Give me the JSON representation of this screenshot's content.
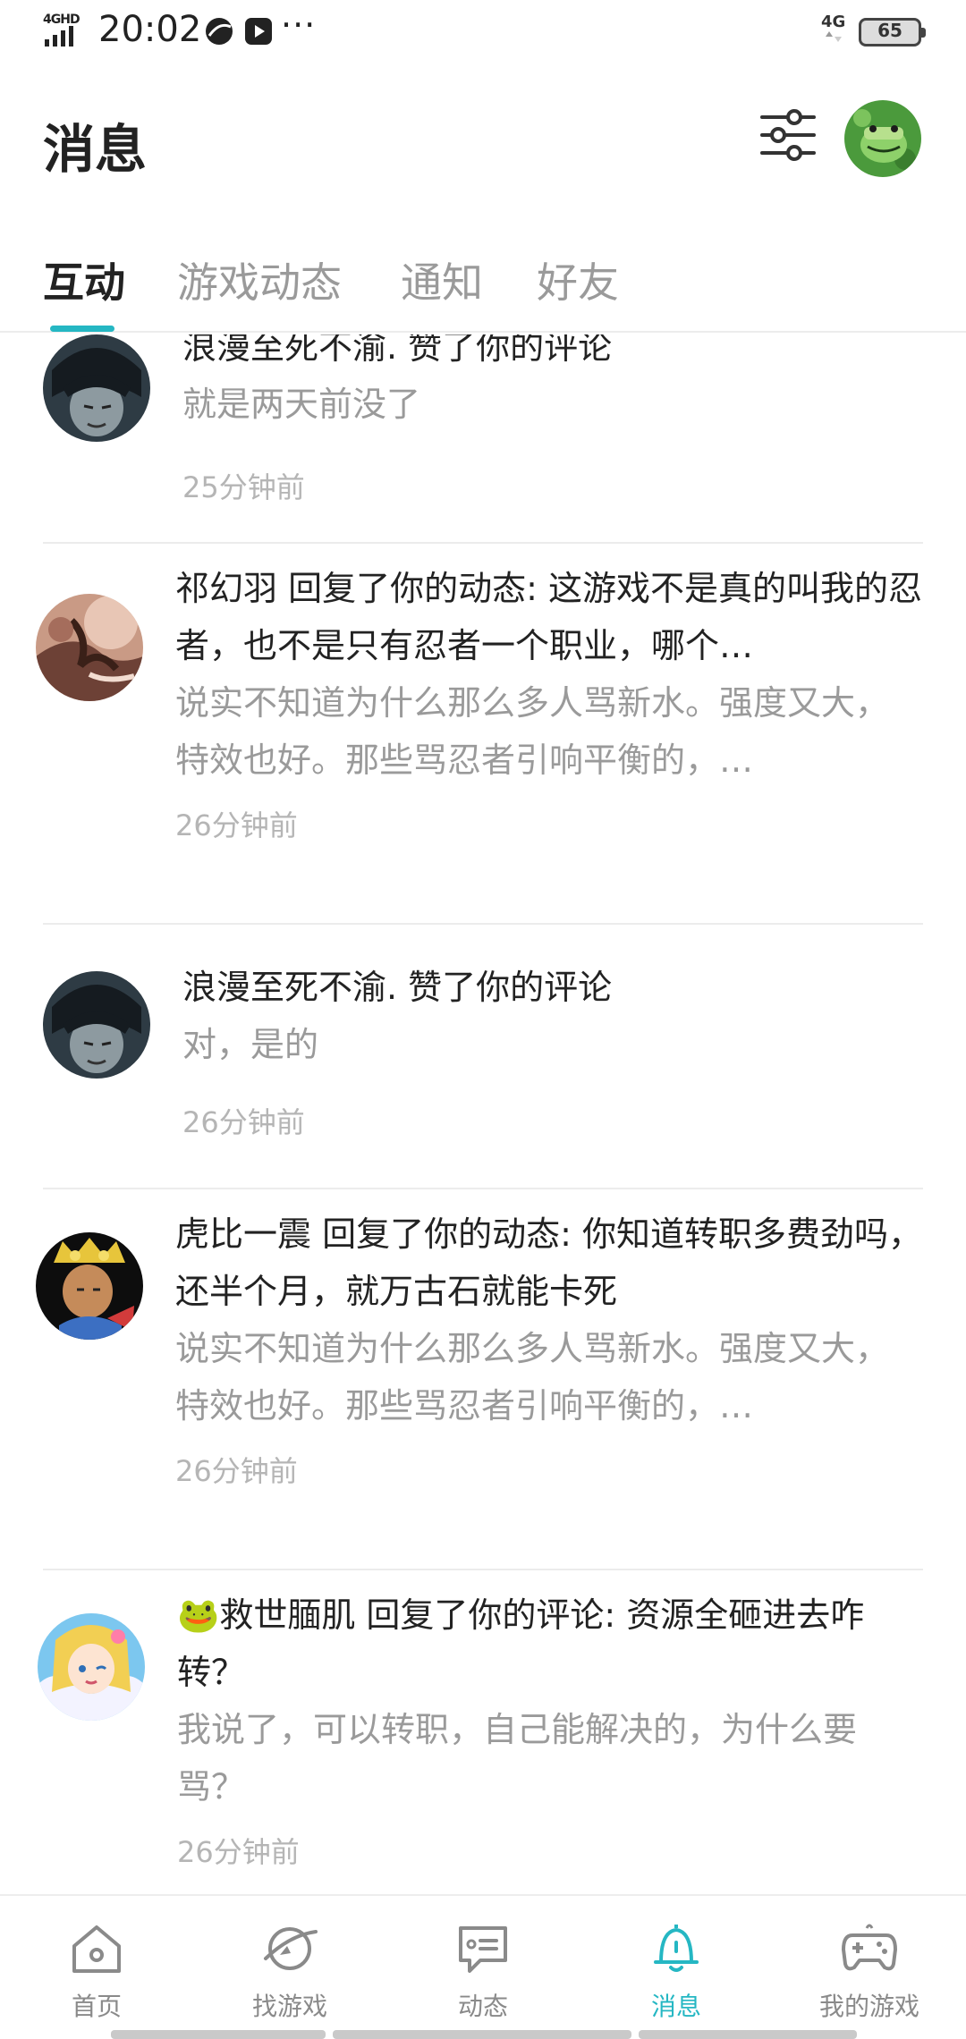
{
  "status_bar": {
    "network_label": "4GHD",
    "time": "20:02",
    "more": "···",
    "signal_label": "4G",
    "battery": "65"
  },
  "header": {
    "title": "消息",
    "filter_icon": "sliders-icon",
    "avatar_icon": "user-avatar"
  },
  "tabs": [
    {
      "label": "互动",
      "active": true
    },
    {
      "label": "游戏动态",
      "active": false
    },
    {
      "label": "通知",
      "active": false
    },
    {
      "label": "好友",
      "active": false
    }
  ],
  "messages": [
    {
      "title": "浪漫至死不渝. 赞了你的评论",
      "snippet": "就是两天前没了",
      "time": "25分钟前"
    },
    {
      "title": "祁幻羽 回复了你的动态: 这游戏不是真的叫我的忍者，也不是只有忍者一个职业，哪个…",
      "snippet": "说实不知道为什么那么多人骂新水。强度又大，特效也好。那些骂忍者引响平衡的，…",
      "time": "26分钟前"
    },
    {
      "title": "浪漫至死不渝. 赞了你的评论",
      "snippet": "对，是的",
      "time": "26分钟前"
    },
    {
      "title": "虎比一震 回复了你的动态: 你知道转职多费劲吗，还半个月，就万古石就能卡死",
      "snippet": "说实不知道为什么那么多人骂新水。强度又大，特效也好。那些骂忍者引响平衡的，…",
      "time": "26分钟前"
    },
    {
      "emoji": "🐸",
      "title": "救世腼肌 回复了你的评论: 资源全砸进去咋转？",
      "snippet": "我说了，可以转职，自己能解决的，为什么要骂？",
      "time": "26分钟前"
    }
  ],
  "bottom_nav": [
    {
      "label": "首页",
      "icon": "home-icon",
      "active": false
    },
    {
      "label": "找游戏",
      "icon": "planet-icon",
      "active": false
    },
    {
      "label": "动态",
      "icon": "chat-icon",
      "active": false
    },
    {
      "label": "消息",
      "icon": "bell-icon",
      "active": true
    },
    {
      "label": "我的游戏",
      "icon": "gamepad-icon",
      "active": false
    }
  ],
  "colors": {
    "accent": "#25b7c3",
    "text": "#222222",
    "muted": "#9a9a9a",
    "time": "#b5b5b5",
    "divider": "#ececec"
  }
}
